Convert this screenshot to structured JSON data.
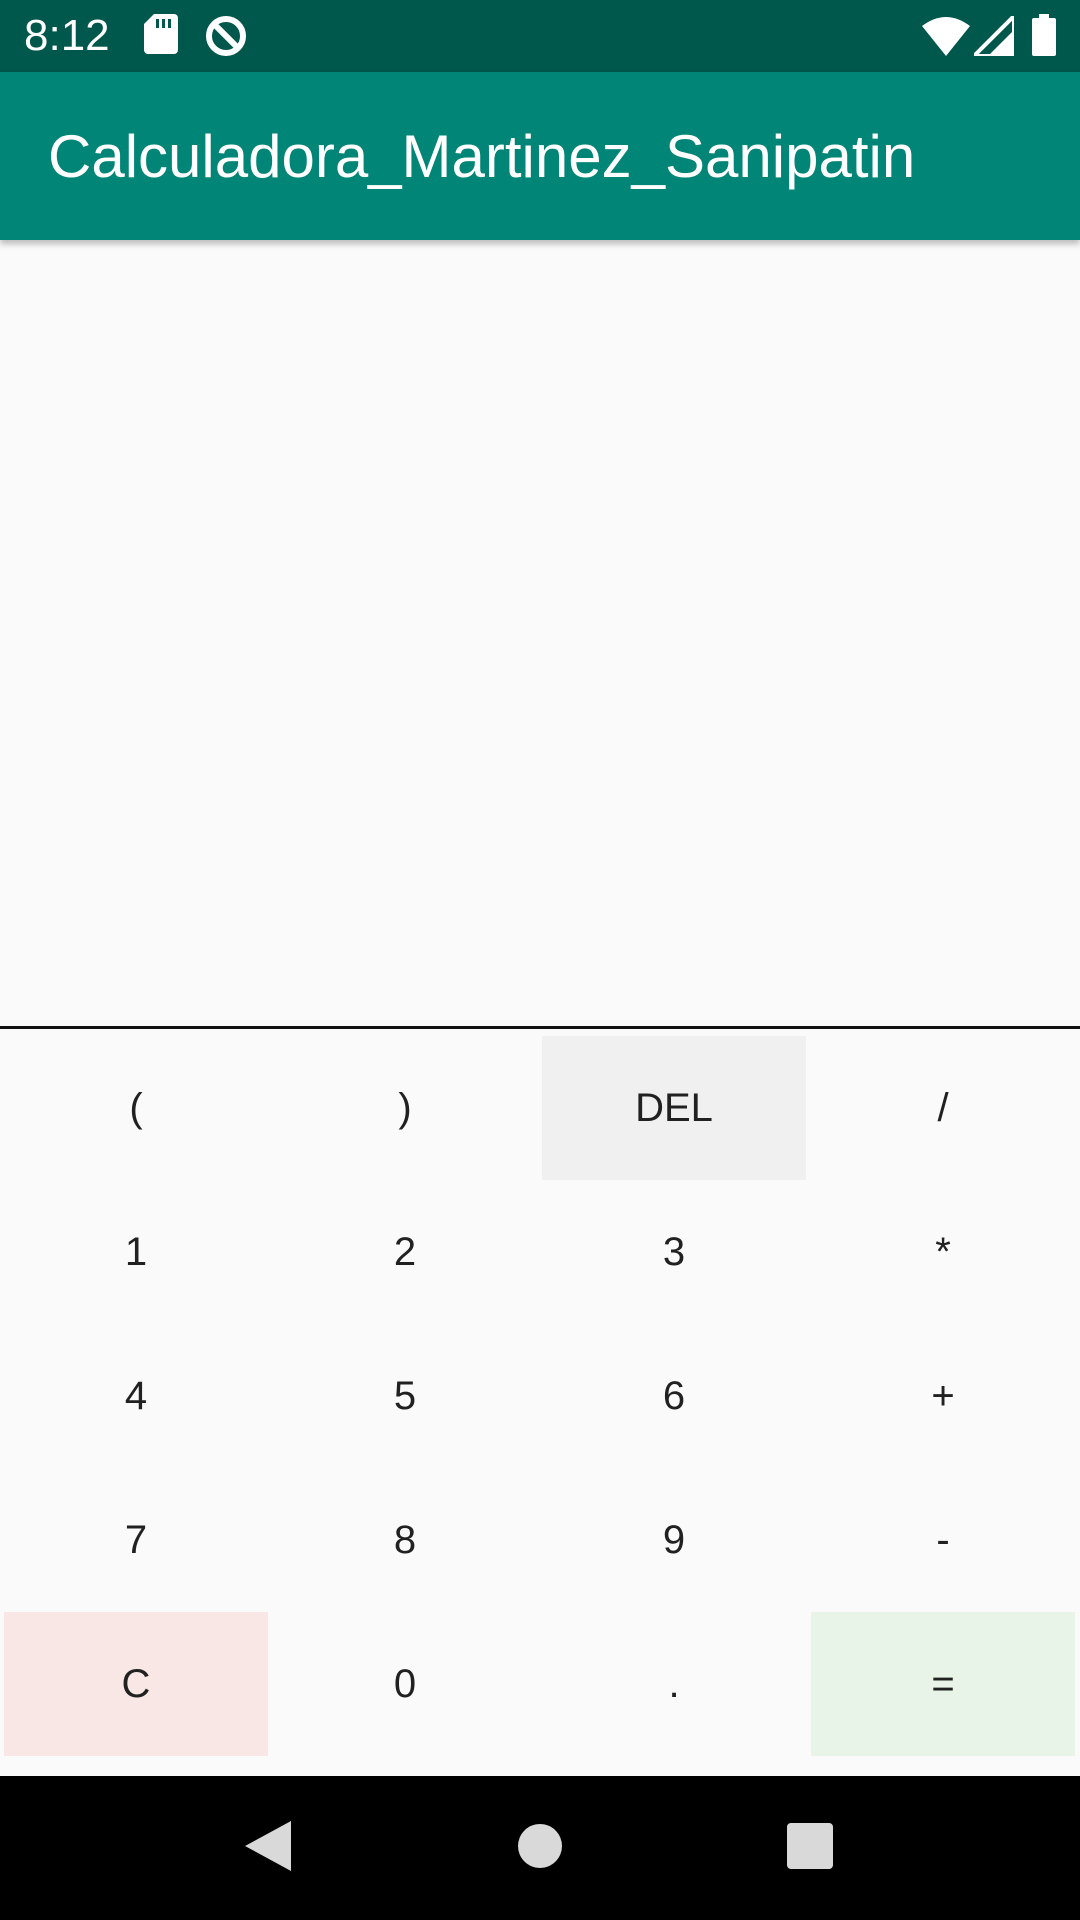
{
  "status_bar": {
    "time": "8:12",
    "icons": [
      "sd-card-icon",
      "data-saver-icon",
      "wifi-icon",
      "cell-signal-icon",
      "battery-icon"
    ],
    "background": "#00574b"
  },
  "app_bar": {
    "title": "Calculadora_Martinez_Sanipatin",
    "background": "#008577"
  },
  "display": {
    "value": ""
  },
  "keypad": {
    "rows": [
      [
        {
          "label": "(",
          "name": "key-open-paren",
          "bg": ""
        },
        {
          "label": ")",
          "name": "key-close-paren",
          "bg": ""
        },
        {
          "label": "DEL",
          "name": "key-delete",
          "bg": "#f0f0f0"
        },
        {
          "label": "/",
          "name": "key-divide",
          "bg": ""
        }
      ],
      [
        {
          "label": "1",
          "name": "key-1",
          "bg": ""
        },
        {
          "label": "2",
          "name": "key-2",
          "bg": ""
        },
        {
          "label": "3",
          "name": "key-3",
          "bg": ""
        },
        {
          "label": "*",
          "name": "key-multiply",
          "bg": ""
        }
      ],
      [
        {
          "label": "4",
          "name": "key-4",
          "bg": ""
        },
        {
          "label": "5",
          "name": "key-5",
          "bg": ""
        },
        {
          "label": "6",
          "name": "key-6",
          "bg": ""
        },
        {
          "label": "+",
          "name": "key-plus",
          "bg": ""
        }
      ],
      [
        {
          "label": "7",
          "name": "key-7",
          "bg": ""
        },
        {
          "label": "8",
          "name": "key-8",
          "bg": ""
        },
        {
          "label": "9",
          "name": "key-9",
          "bg": ""
        },
        {
          "label": "-",
          "name": "key-minus",
          "bg": ""
        }
      ],
      [
        {
          "label": "C",
          "name": "key-clear",
          "bg": "#f9e7e6"
        },
        {
          "label": "0",
          "name": "key-0",
          "bg": ""
        },
        {
          "label": ".",
          "name": "key-decimal",
          "bg": ""
        },
        {
          "label": "=",
          "name": "key-equals",
          "bg": "#e7f4e7"
        }
      ]
    ]
  },
  "nav_bar": {
    "buttons": [
      "back-icon",
      "home-icon",
      "recents-icon"
    ]
  }
}
